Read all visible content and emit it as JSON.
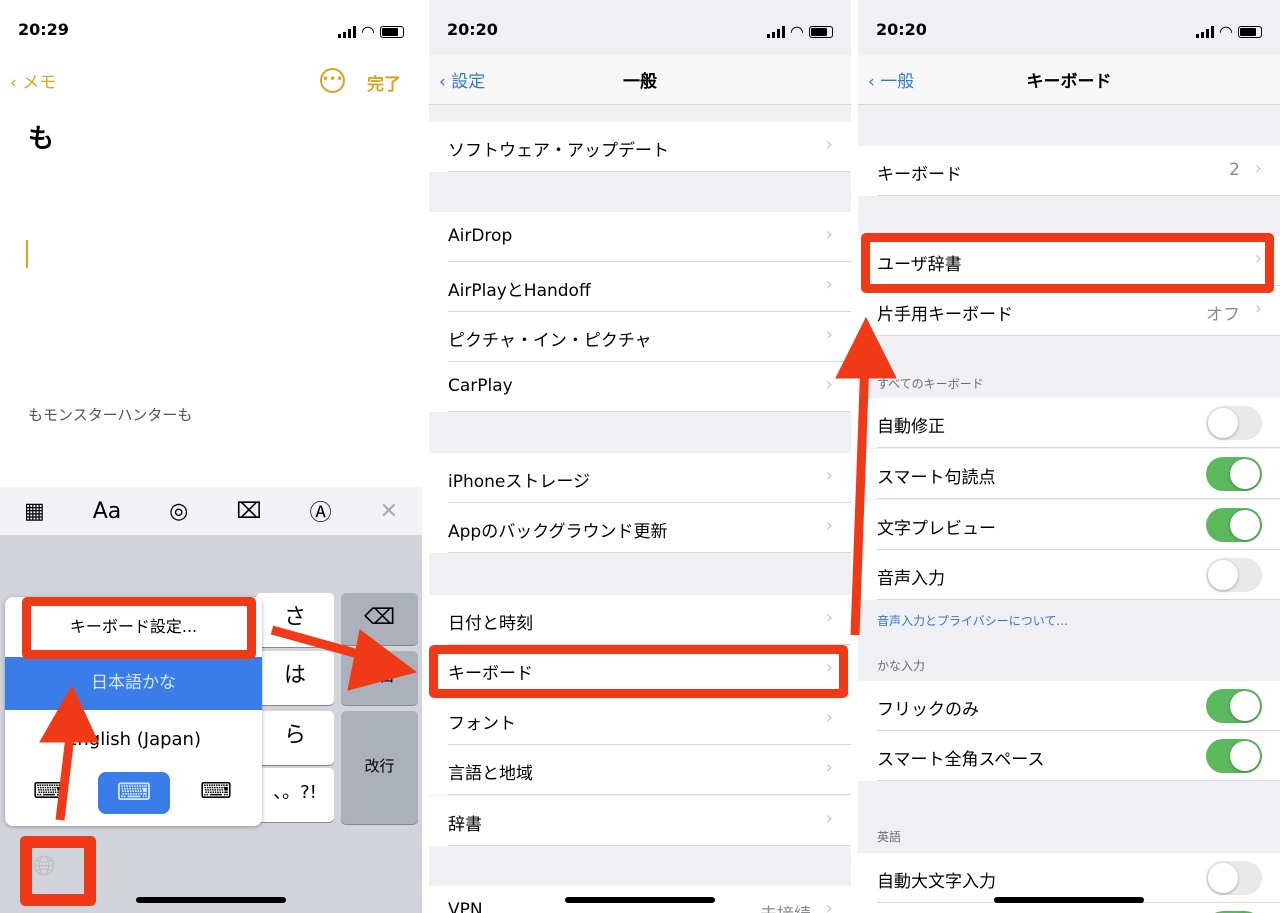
{
  "notes": {
    "time": "20:29",
    "back": "メモ",
    "done": "完了",
    "title": "も",
    "body": "もモンスターハンターも",
    "toolbar": {
      "aa": "Aa"
    },
    "keys": {
      "sa": "さ",
      "ha": "は",
      "ra": "ら",
      "punct": "、。?!",
      "space": "空白",
      "enter": "改行"
    },
    "popup": {
      "settings": "キーボード設定...",
      "japanese": "日本語かな",
      "english": "English (Japan)"
    }
  },
  "general": {
    "time": "20:20",
    "back": "設定",
    "title": "一般",
    "rows": [
      {
        "label": "ソフトウェア・アップデート"
      },
      {
        "label": "AirDrop"
      },
      {
        "label": "AirPlayとHandoff"
      },
      {
        "label": "ピクチャ・イン・ピクチャ"
      },
      {
        "label": "CarPlay"
      },
      {
        "label": "iPhoneストレージ"
      },
      {
        "label": "Appのバックグラウンド更新"
      },
      {
        "label": "日付と時刻"
      },
      {
        "label": "キーボード"
      },
      {
        "label": "フォント"
      },
      {
        "label": "言語と地域"
      },
      {
        "label": "辞書"
      },
      {
        "label": "VPN",
        "value": "未接続"
      }
    ]
  },
  "keyboard": {
    "time": "20:20",
    "back": "一般",
    "title": "キーボード",
    "rows": [
      {
        "label": "キーボード",
        "value": "2"
      },
      {
        "label": "ユーザ辞書"
      },
      {
        "label": "片手用キーボード",
        "value": "オフ"
      },
      {
        "label": "自動修正",
        "toggle": false
      },
      {
        "label": "スマート句読点",
        "toggle": true
      },
      {
        "label": "文字プレビュー",
        "toggle": true
      },
      {
        "label": "音声入力",
        "toggle": false
      },
      {
        "label": "フリックのみ",
        "toggle": true
      },
      {
        "label": "スマート全角スペース",
        "toggle": true
      },
      {
        "label": "自動大文字入力",
        "toggle": false
      },
      {
        "label": "",
        "toggle": true
      }
    ],
    "headers": {
      "all": "すべてのキーボード",
      "kana": "かな入力",
      "english": "英語"
    },
    "privacy_link": "音声入力とプライバシーについて..."
  },
  "colors": {
    "annotation": "#f03a17",
    "ios_blue": "#3478c6",
    "notes_yellow": "#d9a520",
    "toggle_on": "#5cb85c"
  }
}
